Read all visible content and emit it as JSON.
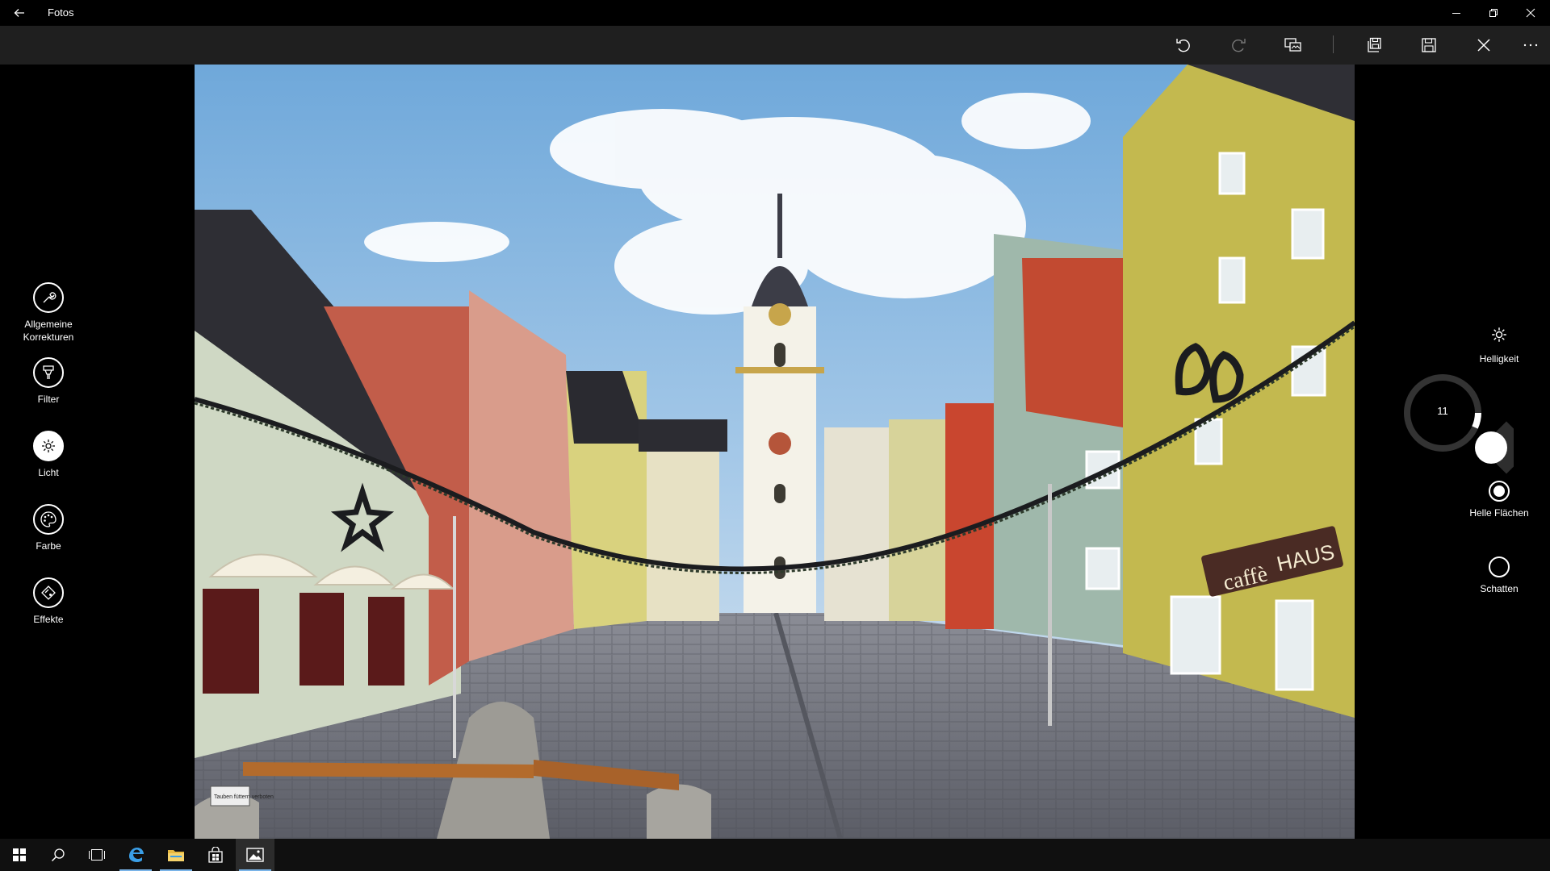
{
  "app": {
    "title": "Fotos"
  },
  "tools": [
    {
      "label": "Allgemeine Korrekturen"
    },
    {
      "label": "Filter"
    },
    {
      "label": "Licht"
    },
    {
      "label": "Farbe"
    },
    {
      "label": "Effekte"
    }
  ],
  "light": {
    "brightness_label": "Helligkeit",
    "dial_value": "11",
    "highlights_label": "Helle Flächen",
    "shadows_label": "Schatten"
  },
  "photo": {
    "signs": {
      "cafe_left": "caffè",
      "cafe_right": "HAUS",
      "small_sign": "Tauben füttern verboten"
    }
  },
  "colors": {
    "accent": "#7ab4e8",
    "toolbar_bg": "#1f1f1f",
    "taskbar_bg": "#101010"
  }
}
